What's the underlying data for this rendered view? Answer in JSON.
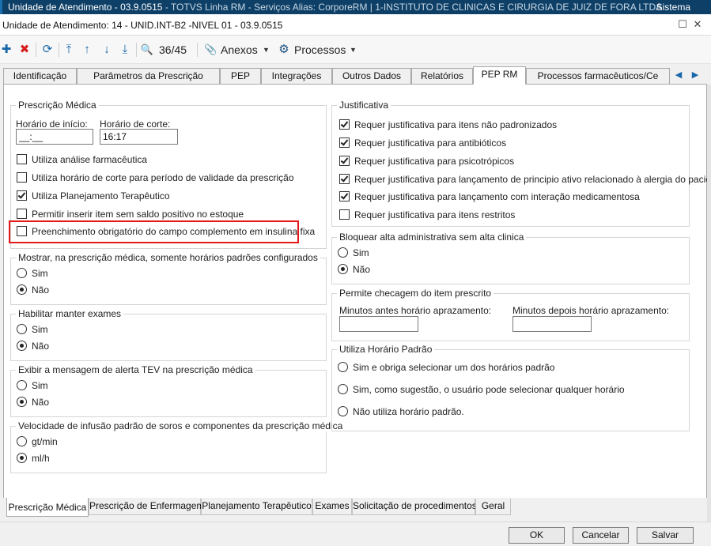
{
  "app_bar": {
    "title_main": "Unidade de Atendimento - 03.9.0515",
    "title_rest": " - TOTVS Linha RM - Serviços  Alias: CorporeRM | 1-INSTITUTO DE CLINICAS E CIRURGIA DE JUIZ DE FORA LTDA",
    "sistema": "Sistema"
  },
  "window": {
    "title": "Unidade de Atendimento: 14 - UNID.INT-B2 -NIVEL 01 - 03.9.0515",
    "restore_glyph": "☐",
    "close_glyph": "✕"
  },
  "toolbar": {
    "icons": {
      "add": "plus-icon",
      "delete": "delete-icon",
      "refresh": "refresh-icon",
      "first": "first-record-icon",
      "prev": "prev-record-icon",
      "next": "next-record-icon",
      "last": "last-record-icon",
      "search": "search-icon",
      "attach": "paperclip-icon",
      "process": "gear-icon"
    },
    "glyphs": {
      "add": "✚",
      "delete": "✖",
      "refresh": "⟳",
      "first": "⤒",
      "prev": "↑",
      "next": "↓",
      "last": "⤓",
      "search": "🔍",
      "attach": "📎",
      "gear": "⚙",
      "dropdown": "▼"
    },
    "record_counter": "36/45",
    "anexos_label": "Anexos",
    "processos_label": "Processos"
  },
  "top_tabs": [
    {
      "label": "Identificação",
      "active": false
    },
    {
      "label": "Parâmetros da Prescrição",
      "active": false
    },
    {
      "label": "PEP",
      "active": false
    },
    {
      "label": "Integrações",
      "active": false
    },
    {
      "label": "Outros Dados",
      "active": false
    },
    {
      "label": "Relatórios",
      "active": false
    },
    {
      "label": "PEP RM",
      "active": true
    },
    {
      "label": "Processos farmacêuticos/Ce",
      "active": false
    }
  ],
  "tab_scroll": {
    "left": "◀",
    "right": "▶"
  },
  "prescricao_medica": {
    "legend": "Prescrição Médica",
    "horario_inicio_label": "Horário de início:",
    "horario_inicio_value": "__:__",
    "horario_corte_label": "Horário de corte:",
    "horario_corte_value": "16:17",
    "options": [
      {
        "label": "Utiliza análise farmacêutica",
        "checked": false
      },
      {
        "label": "Utiliza horário de corte para período de validade da prescrição",
        "checked": false
      },
      {
        "label": "Utiliza Planejamento Terapêutico",
        "checked": true
      },
      {
        "label": "Permitir inserir item sem saldo positivo no estoque",
        "checked": false
      },
      {
        "label": "Preenchimento obrigatório do campo complemento em insulina fixa",
        "checked": false
      }
    ]
  },
  "mostrar_horarios": {
    "legend": "Mostrar, na prescrição médica, somente horários padrões configurados",
    "options": [
      {
        "label": "Sim",
        "selected": false
      },
      {
        "label": "Não",
        "selected": true
      }
    ]
  },
  "habilitar_exames": {
    "legend": "Habilitar manter exames",
    "options": [
      {
        "label": "Sim",
        "selected": false
      },
      {
        "label": "Não",
        "selected": true
      }
    ]
  },
  "alerta_tev": {
    "legend": "Exibir a mensagem de alerta TEV na prescrição médica",
    "options": [
      {
        "label": "Sim",
        "selected": false
      },
      {
        "label": "Não",
        "selected": true
      }
    ]
  },
  "velocidade_infusao": {
    "legend": "Velocidade de infusão padrão de soros e componentes da prescrição médica",
    "options": [
      {
        "label": "gt/min",
        "selected": false
      },
      {
        "label": "ml/h",
        "selected": true
      }
    ]
  },
  "justificativa": {
    "legend": "Justificativa",
    "options": [
      {
        "label": "Requer justificativa para itens não padronizados",
        "checked": true
      },
      {
        "label": "Requer justificativa para antibióticos",
        "checked": true
      },
      {
        "label": "Requer justificativa para psicotrópicos",
        "checked": true
      },
      {
        "label": "Requer justificativa para lançamento de principio ativo relacionado à alergia do paciente",
        "checked": true
      },
      {
        "label": "Requer justificativa para lançamento com interação medicamentosa",
        "checked": true
      },
      {
        "label": "Requer justificativa para itens restritos",
        "checked": false
      }
    ]
  },
  "bloquear_alta": {
    "legend": "Bloquear alta administrativa sem alta clinica",
    "options": [
      {
        "label": "Sim",
        "selected": false
      },
      {
        "label": "Não",
        "selected": true
      }
    ]
  },
  "checagem": {
    "legend": "Permite checagem do item prescrito",
    "antes_label": "Minutos antes horário aprazamento:",
    "antes_value": "",
    "depois_label": "Minutos depois horário aprazamento:",
    "depois_value": ""
  },
  "horario_padrao": {
    "legend": "Utiliza Horário Padrão",
    "options": [
      {
        "label": "Sim e obriga selecionar um dos horários padrão",
        "selected": false
      },
      {
        "label": "Sim, como sugestão, o usuário pode selecionar qualquer horário",
        "selected": false
      },
      {
        "label": "Não utiliza horário padrão.",
        "selected": false
      }
    ]
  },
  "bottom_tabs": [
    {
      "label": "Prescrição Médica",
      "active": true
    },
    {
      "label": "Prescrição de Enfermagem",
      "active": false
    },
    {
      "label": "Planejamento Terapêutico",
      "active": false
    },
    {
      "label": "Exames",
      "active": false
    },
    {
      "label": "Solicitação de procedimentos",
      "active": false
    },
    {
      "label": "Geral",
      "active": false
    }
  ],
  "footer": {
    "ok": "OK",
    "cancel": "Cancelar",
    "save": "Salvar"
  }
}
